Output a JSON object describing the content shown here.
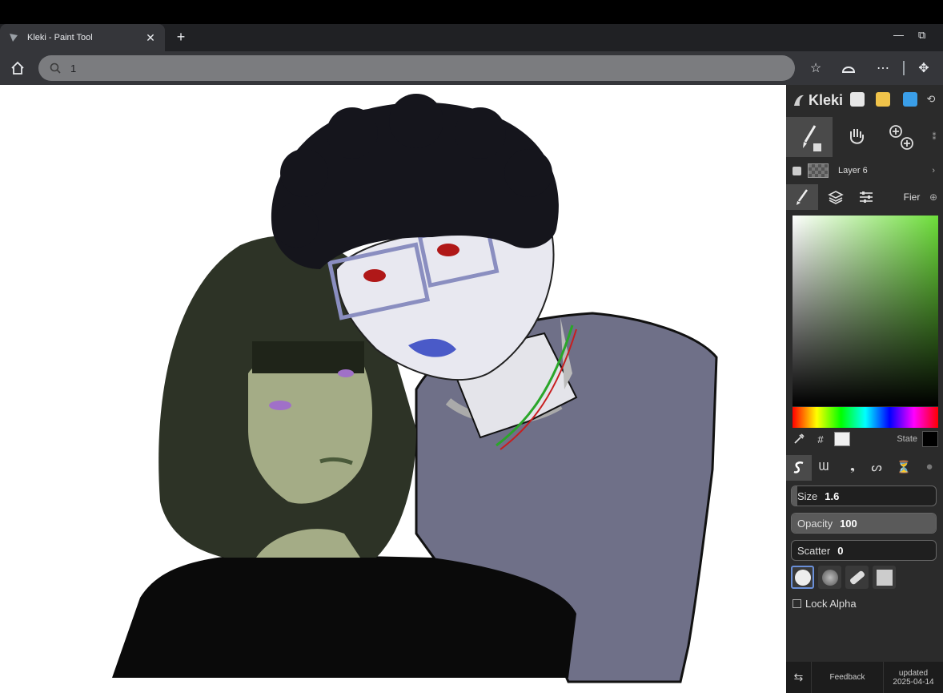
{
  "browser": {
    "tab_title": "Kleki - Paint Tool",
    "tab_close": "✕",
    "new_tab": "+",
    "minimize": "—",
    "restore": "⧉",
    "address_text": "1"
  },
  "panel": {
    "app_name": "Kleki",
    "layer_name": "Layer 6",
    "tab_extra": "Fier",
    "state_label": "State",
    "hash_label": "#",
    "size_label": "Size",
    "size_value": "1.6",
    "size_level": 0.04,
    "opacity_label": "Opacity",
    "opacity_value": "100",
    "opacity_level": 1.0,
    "scatter_label": "Scatter",
    "scatter_value": "0",
    "scatter_level": 0,
    "lock_alpha_label": "Lock Alpha",
    "feedback_label": "Feedback",
    "updated_label": "updated",
    "updated_date": "2025-04-14"
  },
  "colors": {
    "primary_color": "#6dde3a",
    "current_color": "#f0f0f0",
    "secondary_color": "#000000",
    "accent": "#6a8fd8"
  }
}
